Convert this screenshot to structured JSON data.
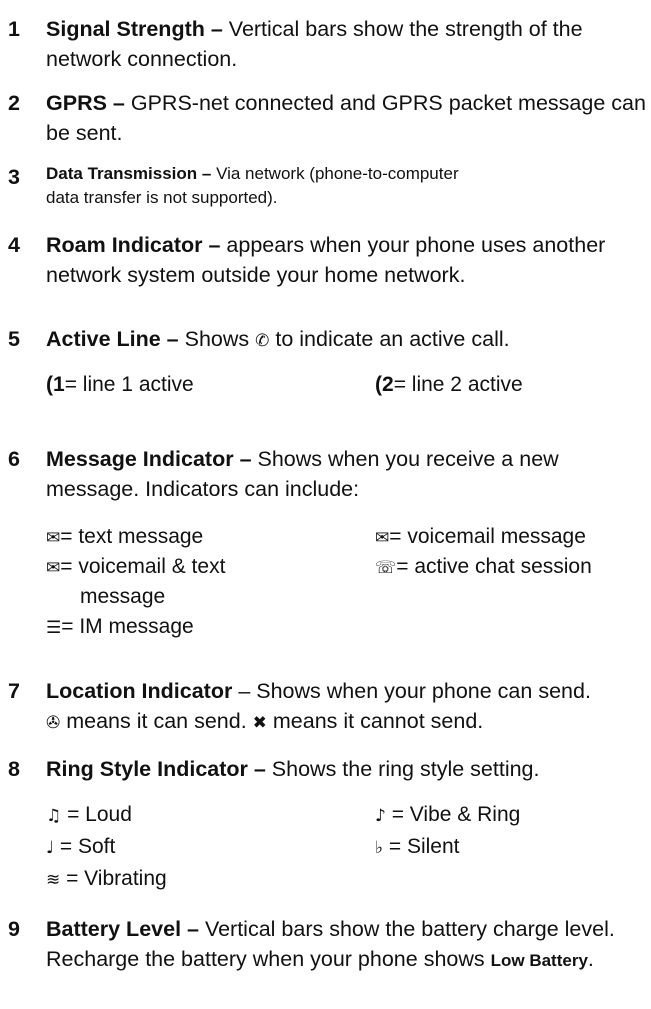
{
  "items": [
    {
      "num": "1",
      "term": "Signal Strength –",
      "text": " Vertical bars show the strength of the network connection."
    },
    {
      "num": "2",
      "term": "GPRS –",
      "text": " GPRS-net connected and GPRS packet message can be sent."
    },
    {
      "num": "3",
      "term": "Data Transmission –",
      "text": " Via network (phone-to-computer data transfer is not supported)."
    },
    {
      "num": "4",
      "term": "Roam Indicator –",
      "text": " appears when your phone uses another network system outside your home network."
    },
    {
      "num": "5",
      "term": "Active Line –",
      "text_before": " Shows ",
      "text_after": " to indicate an active call."
    },
    {
      "num": "6",
      "term": "Message Indicator –",
      "text": " Shows when you receive a new message. Indicators can include:"
    },
    {
      "num": "7",
      "term": "Location Indicator",
      "text": " – Shows when your phone can send."
    },
    {
      "num": "8",
      "term": "Ring Style Indicator –",
      "text": " Shows the ring style setting."
    },
    {
      "num": "9",
      "term": "Battery Level –",
      "text_before": " Vertical bars show the battery charge level. Recharge the battery when your phone shows ",
      "label": "Low Battery",
      "text_after": "."
    }
  ],
  "active_line": {
    "icon": "active-call-icon",
    "line1": {
      "icon": "line1-icon",
      "glyph": "(1",
      "text": "= line 1 active"
    },
    "line2": {
      "icon": "line2-icon",
      "glyph": "(2",
      "text": "= line 2 active"
    }
  },
  "message_indicators": [
    {
      "icon": "text-message-icon",
      "text": "= text message"
    },
    {
      "icon": "voicemail-message-icon",
      "text": "= voicemail message"
    },
    {
      "icon": "voicemail-text-icon",
      "text": "= voicemail & text"
    },
    {
      "icon": "chat-session-icon",
      "text": "= active chat session"
    },
    {
      "icon": "",
      "text": "message"
    },
    {
      "icon": "im-message-icon",
      "text": "= IM message"
    }
  ],
  "location": {
    "can_send_icon": "location-can-send-icon",
    "can_send_text": " means it can send. ",
    "cannot_send_icon": "location-cannot-send-icon",
    "cannot_send_text": " means it cannot send."
  },
  "ring_styles": [
    {
      "icon": "loud-ring-icon",
      "text": " = Loud"
    },
    {
      "icon": "vibe-ring-icon",
      "text": " = Vibe & Ring"
    },
    {
      "icon": "soft-ring-icon",
      "text": " = Soft"
    },
    {
      "icon": "silent-ring-icon",
      "text": " = Silent"
    },
    {
      "icon": "vibrating-icon",
      "text": " = Vibrating"
    }
  ]
}
